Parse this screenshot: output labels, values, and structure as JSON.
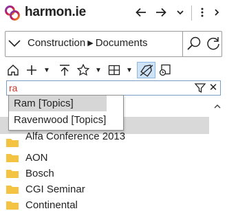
{
  "app": {
    "brand": "harmon.ie"
  },
  "header": {
    "back_icon": "arrow-left-icon",
    "forward_icon": "arrow-right-icon",
    "menu_icon": "chevron-down-icon",
    "more_icon": "vertical-dots-icon",
    "collapse_icon": "chevron-right-icon"
  },
  "location": {
    "path": [
      "Construction",
      "Documents"
    ]
  },
  "toolbar": {
    "items": [
      "home-icon",
      "add-icon",
      "upload-icon",
      "favorite-icon",
      "view-icon",
      "tag-filter-icon",
      "recent-icon"
    ]
  },
  "filter": {
    "value": "ra",
    "value_color": "#c0392b"
  },
  "suggestions": [
    {
      "label": "Ram [Topics]",
      "selected": true
    },
    {
      "label": "Ravenwood [Topics]",
      "selected": false
    }
  ],
  "list": {
    "partial_row_label": "Alfa Conference 2013",
    "rows": [
      {
        "label": "AON"
      },
      {
        "label": "Bosch"
      },
      {
        "label": "CGI Seminar"
      },
      {
        "label": "Continental"
      }
    ]
  },
  "colors": {
    "accent_logo": "#c2185b",
    "folder": "#f5c342",
    "selection": "#d9d9d9",
    "filter_border": "#7a9cc6"
  }
}
